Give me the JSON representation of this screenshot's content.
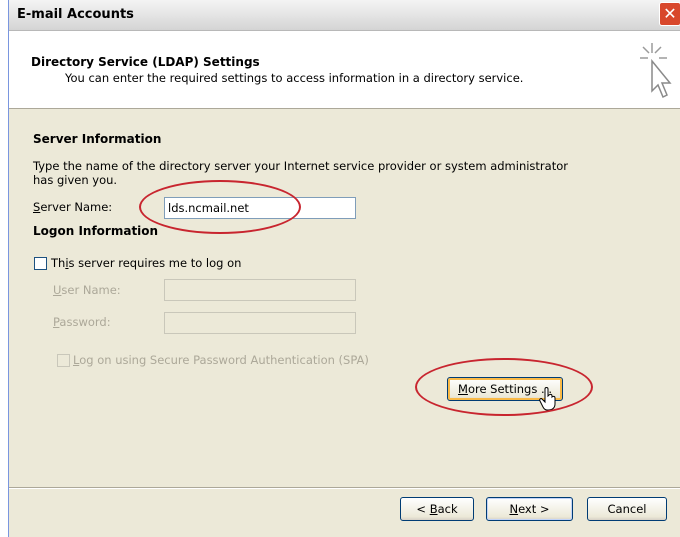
{
  "window": {
    "title": "E-mail Accounts",
    "close_glyph": "✕"
  },
  "header": {
    "title": "Directory Service (LDAP) Settings",
    "subtitle": "You can enter the required settings to access information in a directory service.",
    "icon": "wizard-cursor-icon"
  },
  "server_info": {
    "heading": "Server Information",
    "description_line1": "Type the name of the directory server your Internet service provider or system administrator",
    "description_line2": "has given you.",
    "server_name_label_u": "S",
    "server_name_label_rest": "erver Name:",
    "server_name_value": "lds.ncmail.net"
  },
  "logon_info": {
    "heading": "Logon Information",
    "requires_logon_pre": "Th",
    "requires_logon_u": "i",
    "requires_logon_post": "s server requires me to log on",
    "requires_logon_checked": false,
    "user_name_label_u": "U",
    "user_name_label_rest": "ser Name:",
    "user_name_value": "",
    "password_label_u": "P",
    "password_label_rest": "assword:",
    "password_value": "",
    "spa_label_u": "L",
    "spa_label_rest": "og on using Secure Password Authentication (SPA)",
    "spa_checked": false
  },
  "buttons": {
    "more_settings_u": "M",
    "more_settings_rest": "ore Settings ...",
    "back_pre": "< ",
    "back_u": "B",
    "back_rest": "ack",
    "next_u": "N",
    "next_rest": "ext >",
    "cancel": "Cancel"
  },
  "colors": {
    "annotation_red": "#c8252f",
    "dialog_bg": "#ece9d8",
    "hover_orange": "#f9b946"
  }
}
